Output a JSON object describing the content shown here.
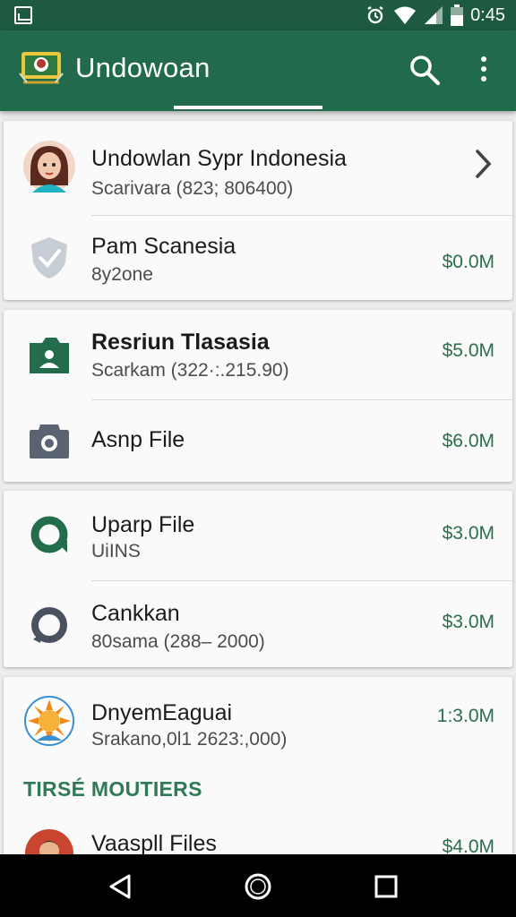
{
  "status_bar": {
    "time": "0:45",
    "icons": [
      "gallery-icon",
      "alarm-icon",
      "wifi-icon",
      "signal-icon",
      "battery-icon"
    ]
  },
  "app_bar": {
    "title": "Undowoan",
    "icons": [
      "app-logo-icon",
      "search-icon",
      "more-vert-icon"
    ]
  },
  "colors": {
    "status_bar": "#1d5a41",
    "app_bar": "#216b4c",
    "accent": "#2c6f4d",
    "nav_bar": "#000000"
  },
  "cards": [
    {
      "rows": [
        {
          "icon": "avatar-woman",
          "title": "Undowlan Sypr Indonesia",
          "subtitle": "Scarivara (823; 806400)",
          "trailing": "chevron-right-icon"
        },
        {
          "icon": "shield-check-icon",
          "title": "Pam Scanesia",
          "subtitle": "8y2one",
          "amount": "$0.0M"
        }
      ]
    },
    {
      "rows": [
        {
          "icon": "folder-person-icon",
          "title": "Resriun Tlasasia",
          "subtitle": "Scarkam (322·:.215.90)",
          "amount": "$5.0M"
        },
        {
          "icon": "camera-icon",
          "title": "Asnp File",
          "amount": "$6.0M"
        }
      ]
    },
    {
      "rows": [
        {
          "icon": "sync-icon",
          "title": "Uparp File",
          "subtitle": "UiINS",
          "amount": "$3.0M"
        },
        {
          "icon": "refresh-icon",
          "title": "Cankkan",
          "subtitle": "80sama (288– 2000)",
          "amount": "$3.0M"
        }
      ]
    },
    {
      "rows": [
        {
          "icon": "avatar-sun",
          "title": "DnyemEaguai",
          "subtitle": "Srakano,0l1  2623:,000)",
          "amount": "1:3.0M"
        }
      ],
      "section_label": "TIRSÉ MOUTIERS",
      "after_section_rows": [
        {
          "icon": "avatar-person",
          "title": "Vaaspll Files",
          "amount": "$4.0M"
        }
      ]
    }
  ],
  "nav_bar": {
    "icons": [
      "back-icon",
      "home-icon",
      "recents-icon"
    ]
  }
}
